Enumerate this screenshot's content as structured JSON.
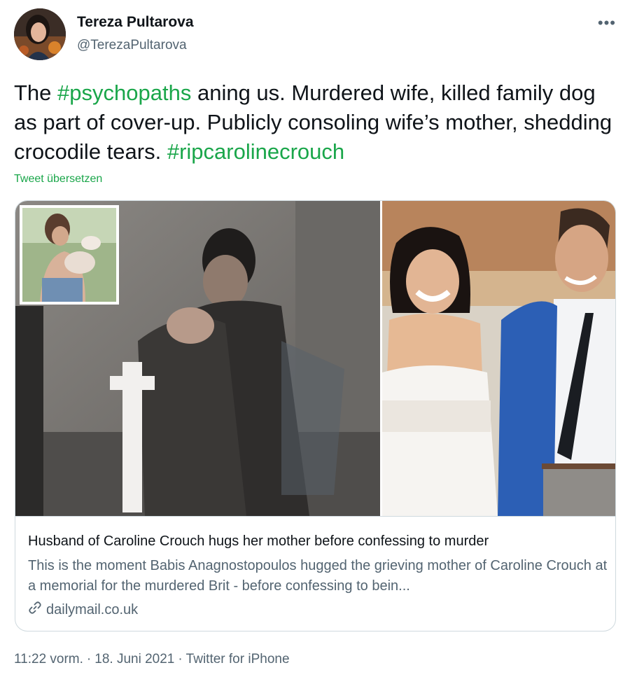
{
  "author": {
    "name": "Tereza Pultarova",
    "handle": "@TerezaPultarova"
  },
  "tweet": {
    "text_parts": [
      {
        "type": "text",
        "value": "The "
      },
      {
        "type": "hashtag",
        "value": "#psychopaths"
      },
      {
        "type": "text",
        "value": " aning us. Murdered wife, killed family dog as part of cover-up. Publicly consoling wife’s mother, shedding crocodile tears. "
      },
      {
        "type": "hashtag",
        "value": "#ripcarolinecrouch"
      }
    ],
    "translate_label": "Tweet übersetzen"
  },
  "link_card": {
    "title": "Husband of Caroline Crouch hugs her mother before confessing to murder",
    "description": "This is the moment Babis Anagnostopoulos hugged the grieving mother of Caroline Crouch at a memorial for the murdered Brit - before confessing to bein...",
    "domain": "dailymail.co.uk"
  },
  "meta": {
    "time": "11:22 vorm.",
    "separator": "·",
    "date": "18. Juni 2021",
    "source": "Twitter for iPhone"
  },
  "colors": {
    "hashtag": "#1aa64a",
    "secondary_text": "#536471",
    "border": "#cfd9de"
  },
  "icons": {
    "more": "more-icon",
    "link": "link-icon"
  }
}
